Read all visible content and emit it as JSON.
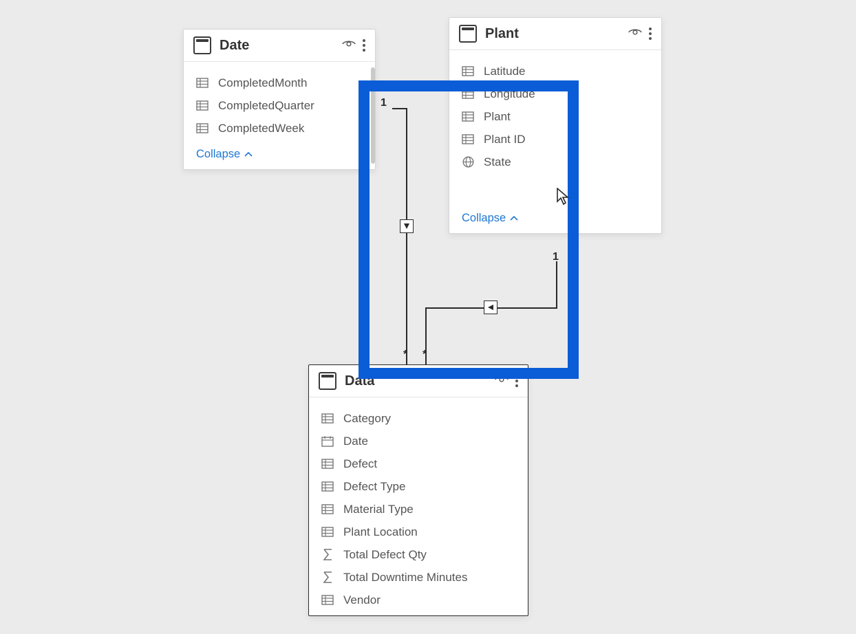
{
  "tables": {
    "date": {
      "title": "Date",
      "collapse_label": "Collapse",
      "fields": [
        {
          "label": "CompletedMonth",
          "icon": "table"
        },
        {
          "label": "CompletedQuarter",
          "icon": "table"
        },
        {
          "label": "CompletedWeek",
          "icon": "table"
        }
      ]
    },
    "plant": {
      "title": "Plant",
      "collapse_label": "Collapse",
      "fields": [
        {
          "label": "Latitude",
          "icon": "table"
        },
        {
          "label": "Longitude",
          "icon": "table"
        },
        {
          "label": "Plant",
          "icon": "table"
        },
        {
          "label": "Plant ID",
          "icon": "table"
        },
        {
          "label": "State",
          "icon": "globe"
        }
      ]
    },
    "data": {
      "title": "Data",
      "fields": [
        {
          "label": "Category",
          "icon": "table"
        },
        {
          "label": "Date",
          "icon": "calendar"
        },
        {
          "label": "Defect",
          "icon": "table"
        },
        {
          "label": "Defect Type",
          "icon": "table"
        },
        {
          "label": "Material Type",
          "icon": "table"
        },
        {
          "label": "Plant Location",
          "icon": "table"
        },
        {
          "label": "Total Defect Qty",
          "icon": "sigma"
        },
        {
          "label": "Total Downtime Minutes",
          "icon": "sigma"
        },
        {
          "label": "Vendor",
          "icon": "table"
        }
      ]
    }
  },
  "relationships": {
    "date_to_data": {
      "one_label": "1",
      "many_label": "*"
    },
    "plant_to_data": {
      "one_label": "1",
      "many_label": "*"
    }
  }
}
